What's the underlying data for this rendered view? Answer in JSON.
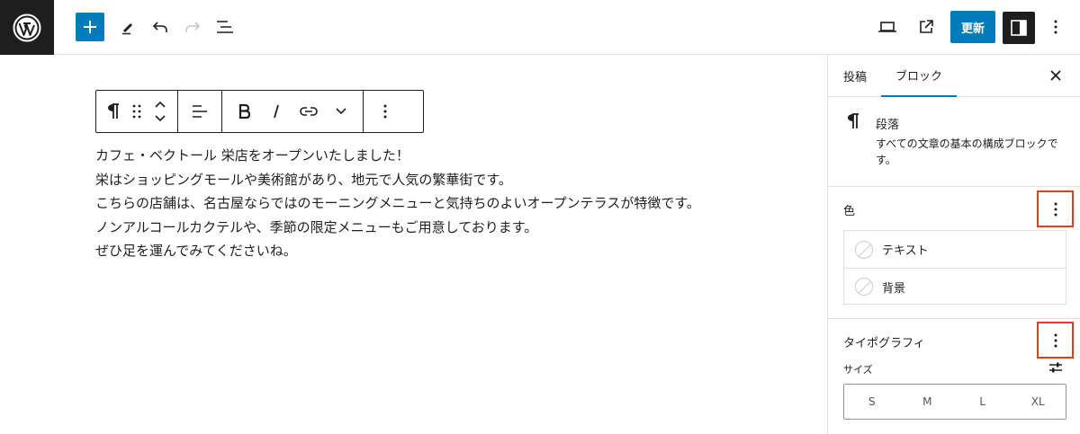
{
  "topbar": {
    "icons": [
      "wordpress-logo",
      "add-block-icon",
      "pen-icon",
      "undo-icon",
      "redo-icon",
      "list-view-icon",
      "desktop-preview-icon",
      "external-link-icon",
      "settings-panel-icon",
      "more-vertical-icon"
    ],
    "update_label": "更新",
    "accent": "#007cba"
  },
  "block_toolbar": {
    "icons": [
      "paragraph-icon",
      "drag-handle-icon",
      "move-up-icon",
      "move-down-icon",
      "align-icon",
      "bold-icon",
      "italic-icon",
      "link-icon",
      "chevron-down-icon",
      "more-vertical-icon"
    ]
  },
  "content": {
    "lines": [
      "カフェ・ベクトール 栄店をオープンいたしました！",
      "栄はショッピングモールや美術館があり、地元で人気の繁華街です。",
      "こちらの店舗は、名古屋ならではのモーニングメニューと気持ちのよいオープンテラスが特徴です。",
      "ノンアルコールカクテルや、季節の限定メニューもご用意しております。",
      "ぜひ足を運んでみてくださいね。"
    ]
  },
  "sidebar": {
    "tabs": [
      {
        "label": "投稿",
        "active": false
      },
      {
        "label": "ブロック",
        "active": true
      }
    ],
    "block": {
      "title": "段落",
      "description": "すべての文章の基本の構成ブロックです。"
    },
    "color_panel": {
      "title": "色",
      "items": [
        "テキスト",
        "背景"
      ]
    },
    "typography_panel": {
      "title": "タイポグラフィ",
      "size_label": "サイズ",
      "size_options": [
        "S",
        "M",
        "L",
        "XL"
      ]
    },
    "highlight_color": "#e2401c"
  }
}
